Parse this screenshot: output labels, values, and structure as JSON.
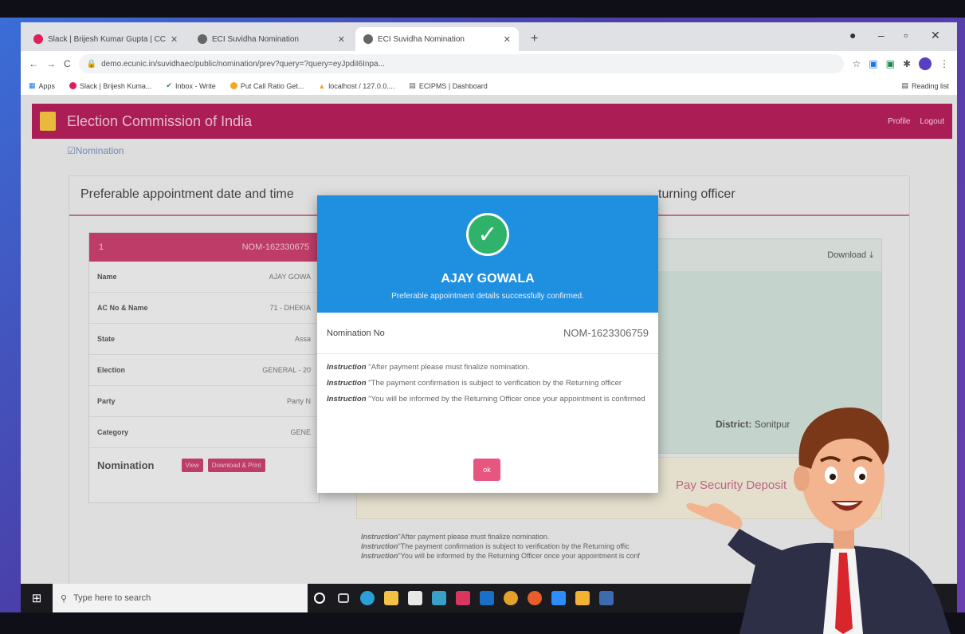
{
  "browser": {
    "tabs": [
      {
        "label": "Slack | Brijesh Kumar Gupta | CC",
        "active": false
      },
      {
        "label": "ECI Suvidha Nomination",
        "active": false
      },
      {
        "label": "ECI Suvidha Nomination",
        "active": true
      }
    ],
    "new_tab": "+",
    "url": "demo.ecunic.in/suvidhaec/public/nomination/prev?query=?query=eyJpdiI6Inpa...",
    "bookmarks": [
      "Apps",
      "Slack | Brijesh Kuma...",
      "Inbox - Write",
      "Put Call Ratio Get...",
      "localhost / 127.0.0....",
      "ECIPMS | Dashboard"
    ],
    "reading_list": "Reading list"
  },
  "app": {
    "title": "Election Commission of India",
    "nav": [
      "Profile",
      "Logout"
    ],
    "breadcrumb": "Nomination",
    "card_title": "Preferable appointment date and time",
    "card_title_right": "turning officer"
  },
  "nomination_card": {
    "index": "1",
    "number": "NOM-162330675",
    "rows": [
      {
        "key": "Name",
        "value": "AJAY GOWA"
      },
      {
        "key": "AC No & Name",
        "value": "71 - DHEKIA"
      },
      {
        "key": "State",
        "value": "Assa"
      },
      {
        "key": "Election",
        "value": "GENERAL - 20"
      },
      {
        "key": "Party",
        "value": "Party N"
      },
      {
        "key": "Category",
        "value": "GENE"
      }
    ],
    "footer_label": "Nomination",
    "view_label": "View",
    "download_label": "Download & Print"
  },
  "right_panel": {
    "download": "Download",
    "district_label": "District:",
    "district_value": "Sonitpur",
    "pay_security": "Pay Security Deposit",
    "instructions": [
      {
        "tag": "Instruction",
        "text": "\"After payment please must finalize nomination."
      },
      {
        "tag": "Instruction",
        "text": "\"The payment confirmation is subject to verification by the Returning offic"
      },
      {
        "tag": "Instruction",
        "text": "\"You will be informed by the Returning Officer once your appointment is conf"
      }
    ]
  },
  "modal": {
    "name": "AJAY GOWALA",
    "subtitle": "Preferable appointment details successfully confirmed.",
    "nom_label": "Nomination No",
    "nom_value": "NOM-1623306759",
    "instructions": [
      {
        "tag": "Instruction",
        "text": "\"After payment please must finalize nomination."
      },
      {
        "tag": "Instruction",
        "text": "\"The payment confirmation is subject to verification by the Returning officer"
      },
      {
        "tag": "Instruction",
        "text": "\"You will be informed by the Returning Officer once your appointment is confirmed"
      }
    ],
    "ok": "ok"
  },
  "taskbar": {
    "search_placeholder": "Type here to search",
    "apps": [
      "cortana",
      "task-view",
      "edge",
      "file-explorer",
      "store",
      "teams",
      "mail",
      "outlook",
      "chrome",
      "firefox",
      "zoom",
      "sticky-notes",
      "calculator"
    ]
  },
  "colors": {
    "brand": "#b51f5a",
    "modal_header": "#1f8fe0",
    "success": "#2fb26a",
    "ok_button": "#e8557f"
  }
}
